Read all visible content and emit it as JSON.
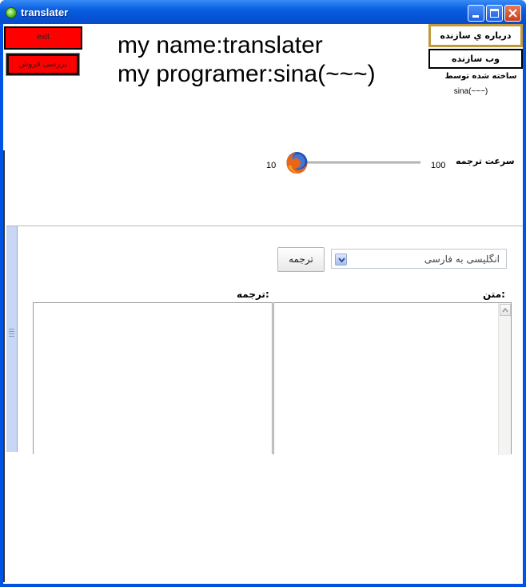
{
  "window": {
    "title": "translater"
  },
  "buttons": {
    "exit": "exit",
    "sales": "بررسی فروش",
    "about": "درباره ي سازنده",
    "web": "وب سازنده",
    "translate": "ترجمه"
  },
  "headline": {
    "line1": "my name:translater",
    "line2": "my programer:sina(~~~)"
  },
  "credits": {
    "made_by": "ساخته شده توسط",
    "author": "sina(~~~)"
  },
  "speed": {
    "label": "سرعت ترجمه",
    "min": "10",
    "max": "100",
    "value": 10
  },
  "translator": {
    "language": "انگلیسی به فارسی",
    "source_label": "متن:",
    "target_label": "ترجمه:"
  },
  "colors": {
    "title_bar": "#0a5fe0",
    "button_red": "#ff0000",
    "about_border": "#c09a3c"
  },
  "icons": {
    "app": "app-icon",
    "slider_thumb": "firefox-icon"
  }
}
